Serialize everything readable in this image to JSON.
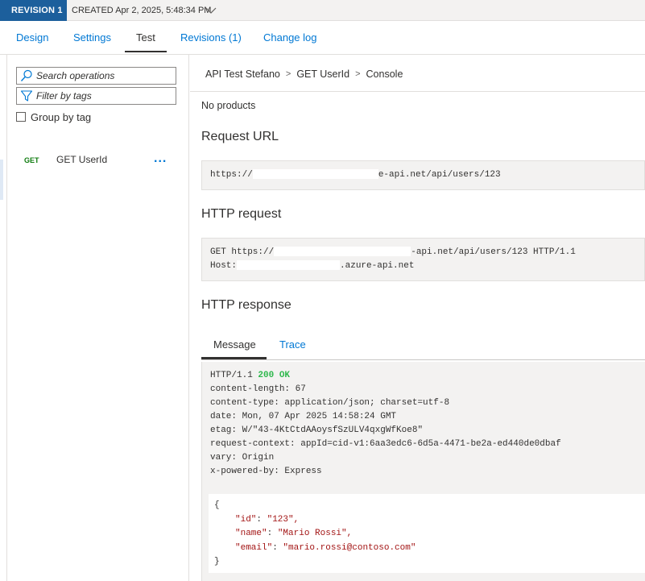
{
  "revision": {
    "badge": "REVISION 1",
    "created": "CREATED Apr 2, 2025, 5:48:34 PM"
  },
  "tabs": [
    {
      "label": "Design"
    },
    {
      "label": "Settings"
    },
    {
      "label": "Test",
      "active": true
    },
    {
      "label": "Revisions (1)"
    },
    {
      "label": "Change log"
    }
  ],
  "left": {
    "search_placeholder": "Search operations",
    "filter_placeholder": "Filter by tags",
    "group_by_label": "Group by tag",
    "group_by_checked": false,
    "operation": {
      "method": "GET",
      "name": "GET UserId",
      "more": "..."
    }
  },
  "breadcrumb": [
    "API Test Stefano",
    "GET UserId",
    "Console"
  ],
  "breadcrumb_sep": ">",
  "no_products": "No products",
  "request_url": {
    "title": "Request URL",
    "prefix": "https://",
    "suffix": "e-api.net/api/users/123"
  },
  "http_request": {
    "title": "HTTP request",
    "line1_prefix": "GET https://",
    "line1_suffix": "-api.net/api/users/123 HTTP/1.1",
    "line2_prefix": "Host:",
    "line2_suffix": ".azure-api.net"
  },
  "http_response": {
    "title": "HTTP response",
    "tabs": {
      "message": "Message",
      "trace": "Trace"
    },
    "status_prefix": "HTTP/1.1",
    "status_code": "200 OK",
    "headers": [
      "content-length: 67",
      "content-type: application/json; charset=utf-8",
      "date: Mon, 07 Apr 2025 14:58:24 GMT",
      "etag: W/\"43-4KtCtdAAoysfSzULV4qxgWfKoe8\"",
      "request-context: appId=cid-v1:6aa3edc6-6d5a-4471-be2a-ed440de0dbaf",
      "vary: Origin",
      "x-powered-by: Express"
    ],
    "body": {
      "open": "{",
      "close": "}",
      "fields": [
        {
          "key": "\"id\"",
          "value": "\"123\","
        },
        {
          "key": "\"name\"",
          "value": "\"Mario Rossi\","
        },
        {
          "key": "\"email\"",
          "value": "\"mario.rossi@contoso.com\""
        }
      ]
    }
  },
  "colors": {
    "accent": "#0078d4",
    "revision_badge": "#1c5f9c",
    "status_ok": "#2fb84d",
    "method_get": "#107c10",
    "json_string": "#a31515"
  }
}
